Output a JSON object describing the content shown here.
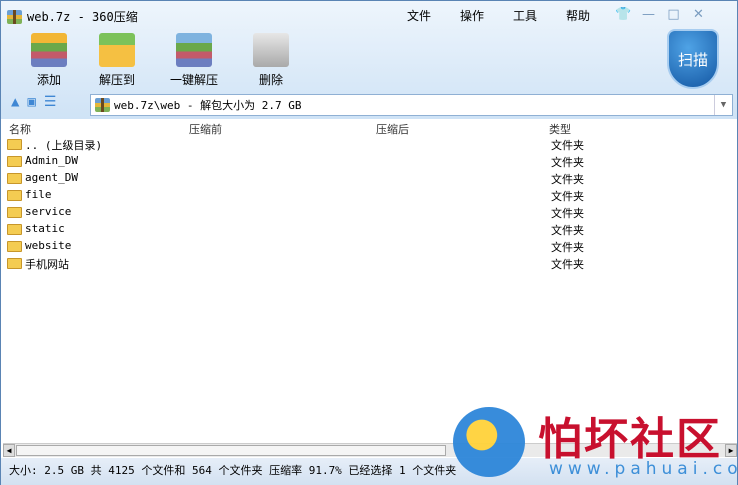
{
  "window": {
    "title": "web.7z - 360压缩"
  },
  "menu": [
    "文件",
    "操作",
    "工具",
    "帮助"
  ],
  "toolbar": [
    {
      "label": "添加",
      "icon": "add-archive-icon"
    },
    {
      "label": "解压到",
      "icon": "extract-to-icon"
    },
    {
      "label": "一键解压",
      "icon": "one-click-extract-icon"
    },
    {
      "label": "删除",
      "icon": "trash-icon"
    }
  ],
  "scan_label": "扫描",
  "address": {
    "value": "web.7z\\web - 解包大小为 2.7 GB"
  },
  "columns": {
    "name": "名称",
    "before": "压缩前",
    "after": "压缩后",
    "type": "类型"
  },
  "rows": [
    {
      "name": ".. (上级目录)",
      "type": "文件夹"
    },
    {
      "name": "Admin_DW",
      "type": "文件夹"
    },
    {
      "name": "agent_DW",
      "type": "文件夹"
    },
    {
      "name": "file",
      "type": "文件夹"
    },
    {
      "name": "service",
      "type": "文件夹"
    },
    {
      "name": "static",
      "type": "文件夹"
    },
    {
      "name": "website",
      "type": "文件夹"
    },
    {
      "name": "手机网站",
      "type": "文件夹"
    }
  ],
  "status": "大小: 2.5 GB 共 4125 个文件和 564 个文件夹 压缩率 91.7% 已经选择 1 个文件夹",
  "watermark": {
    "title": "怕坏社区",
    "url": "www.pahuai.com"
  }
}
